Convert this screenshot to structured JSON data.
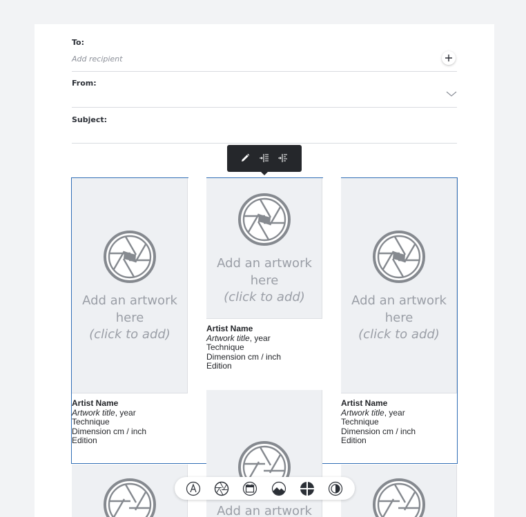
{
  "form": {
    "to_label": "To:",
    "to_placeholder": "Add recipient",
    "from_label": "From:",
    "subject_label": "Subject:"
  },
  "toolbar": {
    "icons": [
      "pencil-icon",
      "indent-left-icon",
      "indent-right-icon"
    ]
  },
  "placeholder": {
    "line1": "Add an artwork",
    "line2": "here",
    "line3": "(click to add)"
  },
  "cards": [
    {
      "artist": "Artist Name",
      "title": "Artwork title",
      "year_suffix": ", year",
      "technique": "Technique",
      "dimension": "Dimension cm / inch",
      "edition": "Edition"
    },
    {
      "artist": "Artist Name",
      "title": "Artwork title",
      "year_suffix": ", year",
      "technique": "Technique",
      "dimension": "Dimension cm / inch",
      "edition": "Edition"
    },
    {
      "artist": "Artist Name",
      "title": "Artwork title",
      "year_suffix": ", year",
      "technique": "Technique",
      "dimension": "Dimension cm / inch",
      "edition": "Edition"
    }
  ],
  "bottom_toolbar": {
    "icons": [
      "pen-nib-icon",
      "aperture-icon",
      "calendar-icon",
      "image-icon",
      "crosshair-icon",
      "contrast-icon"
    ]
  },
  "colors": {
    "selection": "#2f6db5",
    "toolbar_bg": "#25272b",
    "placeholder_bg": "#eef0f3",
    "placeholder_text": "#9a9ea6"
  }
}
